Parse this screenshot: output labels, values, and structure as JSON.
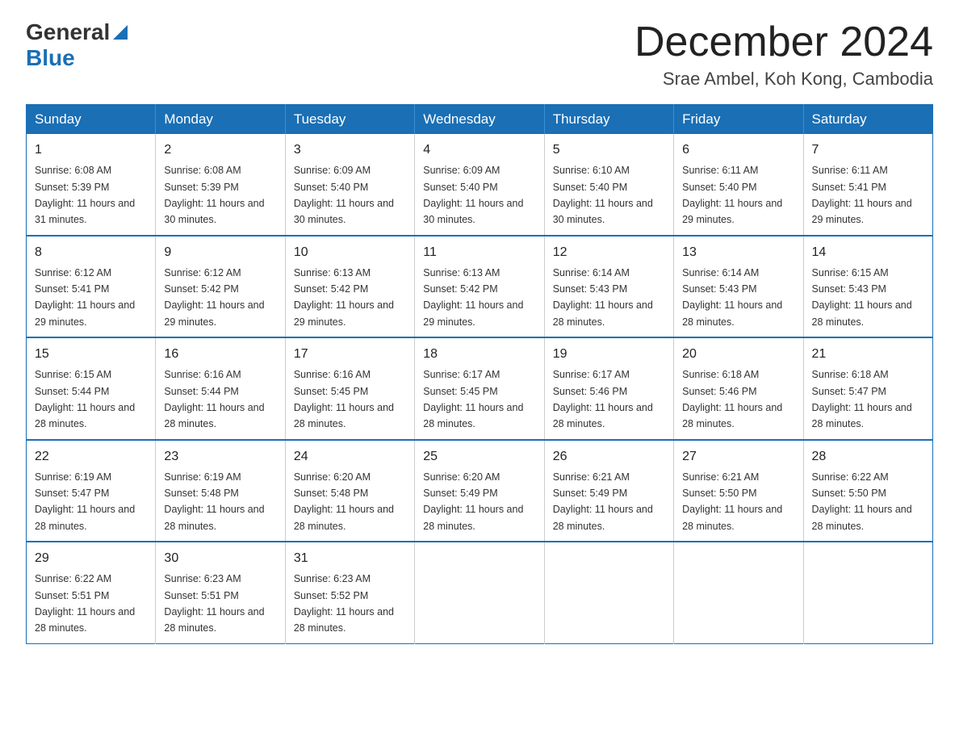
{
  "header": {
    "logo_general": "General",
    "logo_blue": "Blue",
    "month_title": "December 2024",
    "location": "Srae Ambel, Koh Kong, Cambodia"
  },
  "weekdays": [
    "Sunday",
    "Monday",
    "Tuesday",
    "Wednesday",
    "Thursday",
    "Friday",
    "Saturday"
  ],
  "weeks": [
    [
      {
        "day": "1",
        "sunrise": "6:08 AM",
        "sunset": "5:39 PM",
        "daylight": "11 hours and 31 minutes."
      },
      {
        "day": "2",
        "sunrise": "6:08 AM",
        "sunset": "5:39 PM",
        "daylight": "11 hours and 30 minutes."
      },
      {
        "day": "3",
        "sunrise": "6:09 AM",
        "sunset": "5:40 PM",
        "daylight": "11 hours and 30 minutes."
      },
      {
        "day": "4",
        "sunrise": "6:09 AM",
        "sunset": "5:40 PM",
        "daylight": "11 hours and 30 minutes."
      },
      {
        "day": "5",
        "sunrise": "6:10 AM",
        "sunset": "5:40 PM",
        "daylight": "11 hours and 30 minutes."
      },
      {
        "day": "6",
        "sunrise": "6:11 AM",
        "sunset": "5:40 PM",
        "daylight": "11 hours and 29 minutes."
      },
      {
        "day": "7",
        "sunrise": "6:11 AM",
        "sunset": "5:41 PM",
        "daylight": "11 hours and 29 minutes."
      }
    ],
    [
      {
        "day": "8",
        "sunrise": "6:12 AM",
        "sunset": "5:41 PM",
        "daylight": "11 hours and 29 minutes."
      },
      {
        "day": "9",
        "sunrise": "6:12 AM",
        "sunset": "5:42 PM",
        "daylight": "11 hours and 29 minutes."
      },
      {
        "day": "10",
        "sunrise": "6:13 AM",
        "sunset": "5:42 PM",
        "daylight": "11 hours and 29 minutes."
      },
      {
        "day": "11",
        "sunrise": "6:13 AM",
        "sunset": "5:42 PM",
        "daylight": "11 hours and 29 minutes."
      },
      {
        "day": "12",
        "sunrise": "6:14 AM",
        "sunset": "5:43 PM",
        "daylight": "11 hours and 28 minutes."
      },
      {
        "day": "13",
        "sunrise": "6:14 AM",
        "sunset": "5:43 PM",
        "daylight": "11 hours and 28 minutes."
      },
      {
        "day": "14",
        "sunrise": "6:15 AM",
        "sunset": "5:43 PM",
        "daylight": "11 hours and 28 minutes."
      }
    ],
    [
      {
        "day": "15",
        "sunrise": "6:15 AM",
        "sunset": "5:44 PM",
        "daylight": "11 hours and 28 minutes."
      },
      {
        "day": "16",
        "sunrise": "6:16 AM",
        "sunset": "5:44 PM",
        "daylight": "11 hours and 28 minutes."
      },
      {
        "day": "17",
        "sunrise": "6:16 AM",
        "sunset": "5:45 PM",
        "daylight": "11 hours and 28 minutes."
      },
      {
        "day": "18",
        "sunrise": "6:17 AM",
        "sunset": "5:45 PM",
        "daylight": "11 hours and 28 minutes."
      },
      {
        "day": "19",
        "sunrise": "6:17 AM",
        "sunset": "5:46 PM",
        "daylight": "11 hours and 28 minutes."
      },
      {
        "day": "20",
        "sunrise": "6:18 AM",
        "sunset": "5:46 PM",
        "daylight": "11 hours and 28 minutes."
      },
      {
        "day": "21",
        "sunrise": "6:18 AM",
        "sunset": "5:47 PM",
        "daylight": "11 hours and 28 minutes."
      }
    ],
    [
      {
        "day": "22",
        "sunrise": "6:19 AM",
        "sunset": "5:47 PM",
        "daylight": "11 hours and 28 minutes."
      },
      {
        "day": "23",
        "sunrise": "6:19 AM",
        "sunset": "5:48 PM",
        "daylight": "11 hours and 28 minutes."
      },
      {
        "day": "24",
        "sunrise": "6:20 AM",
        "sunset": "5:48 PM",
        "daylight": "11 hours and 28 minutes."
      },
      {
        "day": "25",
        "sunrise": "6:20 AM",
        "sunset": "5:49 PM",
        "daylight": "11 hours and 28 minutes."
      },
      {
        "day": "26",
        "sunrise": "6:21 AM",
        "sunset": "5:49 PM",
        "daylight": "11 hours and 28 minutes."
      },
      {
        "day": "27",
        "sunrise": "6:21 AM",
        "sunset": "5:50 PM",
        "daylight": "11 hours and 28 minutes."
      },
      {
        "day": "28",
        "sunrise": "6:22 AM",
        "sunset": "5:50 PM",
        "daylight": "11 hours and 28 minutes."
      }
    ],
    [
      {
        "day": "29",
        "sunrise": "6:22 AM",
        "sunset": "5:51 PM",
        "daylight": "11 hours and 28 minutes."
      },
      {
        "day": "30",
        "sunrise": "6:23 AM",
        "sunset": "5:51 PM",
        "daylight": "11 hours and 28 minutes."
      },
      {
        "day": "31",
        "sunrise": "6:23 AM",
        "sunset": "5:52 PM",
        "daylight": "11 hours and 28 minutes."
      },
      null,
      null,
      null,
      null
    ]
  ]
}
